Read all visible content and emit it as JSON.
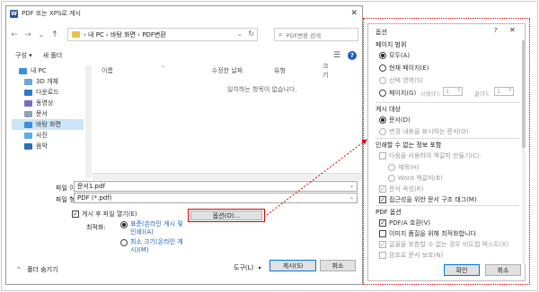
{
  "save_dialog": {
    "title": "PDF 또는 XPS로 게시",
    "nav": {
      "back": "←",
      "forward": "→",
      "recent": "⌄",
      "up": "↑"
    },
    "breadcrumb": "›  내 PC  ›  바탕 화면  ›  PDF변환",
    "search_placeholder": "PDF변환 검색",
    "toolbar": {
      "organize": "구성 ▾",
      "new_folder": "새 폴더"
    },
    "sidebar": [
      {
        "label": "내 PC",
        "icon": "pc-icon",
        "color": "#3a8fd9"
      },
      {
        "label": "3D 개체",
        "icon": "cube-icon",
        "color": "#6aa7e0"
      },
      {
        "label": "다운로드",
        "icon": "download-icon",
        "color": "#2b79c9"
      },
      {
        "label": "동영상",
        "icon": "video-icon",
        "color": "#7a6bc1"
      },
      {
        "label": "문서",
        "icon": "document-icon",
        "color": "#8aa3b8"
      },
      {
        "label": "바탕 화면",
        "icon": "desktop-icon",
        "color": "#3a8fd9",
        "selected": true
      },
      {
        "label": "사진",
        "icon": "picture-icon",
        "color": "#5aaee6"
      },
      {
        "label": "음악",
        "icon": "music-icon",
        "color": "#2d6fb8"
      }
    ],
    "columns": [
      "이름",
      "수정한 날짜",
      "유형",
      "크기"
    ],
    "empty_message": "일치하는 항목이 없습니다.",
    "filename_label": "파일 이름(N):",
    "filename_value": "문서1.pdf",
    "filetype_label": "파일 형식(T):",
    "filetype_value": "PDF (*.pdf)",
    "open_after_label": "게시 후 파일 열기(E)",
    "optimize_label": "최적화:",
    "opt_standard": "표준(온라인 게시 및 인쇄)(A)",
    "opt_minimum": "최소 크기(온라인 게시)(M)",
    "options_button": "옵션(O)...",
    "hide_folders": "폴더 숨기기",
    "tools": "도구(L)",
    "publish": "게시(S)",
    "cancel": "취소"
  },
  "options_dialog": {
    "title": "옵션",
    "help": "?",
    "close": "✕",
    "page_range": "페이지 범위",
    "all": "모두(A)",
    "current_page": "현재 페이지(E)",
    "selection": "선택 영역(S)",
    "pages": "페이지(G)",
    "from_label": "시작(F):",
    "from_value": "1",
    "to_label": "끝(T):",
    "to_value": "1",
    "publish_what": "게시 대상",
    "document": "문서(D)",
    "doc_markup": "변경 내용을 표시하는 문서(O)",
    "nonprint_info": "인쇄할 수 없는 정보 포함",
    "create_bookmarks": "다음을 사용하여 책갈피 만들기(C):",
    "headings": "제목(H)",
    "word_bookmarks": "Word 책갈피(B)",
    "doc_properties": "문서 속성(R)",
    "structure_tags": "접근성을 위한 문서 구조 태그(M)",
    "pdf_options": "PDF 옵션",
    "pdfa": "PDF/A 호환(V)",
    "optimize_images": "이미지 품질을 위해 최적화합니다",
    "bitmap_text": "글꼴을 포함할 수 없는 경우 비트맵 텍스트(X)",
    "encrypt": "암호로 문서 보호(N)",
    "ok": "확인",
    "cancel": "취소"
  },
  "accent_red": "#e00000"
}
